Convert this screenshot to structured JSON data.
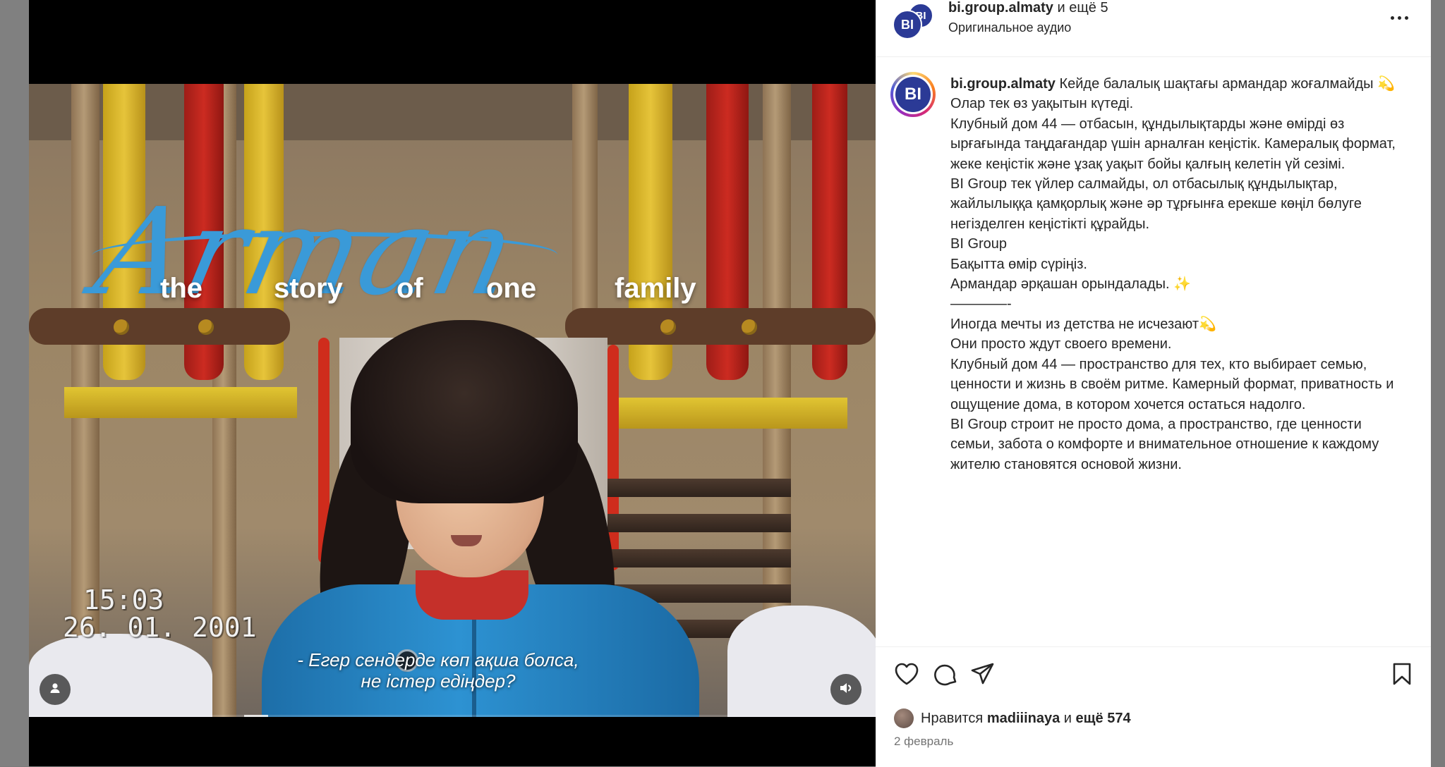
{
  "video": {
    "title_script": "Arman",
    "subtitle_words": [
      "the",
      "story",
      "of",
      "one",
      "family"
    ],
    "timestamp_time": "15:03",
    "timestamp_date": "26. 01. 2001",
    "caption_line1": "- Егер сендерде көп ақша болса,",
    "caption_line2": "не істер едіңдер?",
    "progress": 0.03
  },
  "post_header": {
    "username": "bi.group.almaty",
    "collab_text": "и ещё 5",
    "audio": "Оригинальное аудио",
    "avatar_text": "BI"
  },
  "post_caption": {
    "username": "bi.group.almaty",
    "avatar_text": "BI",
    "first_line": "Кейде балалық шақтағы армандар жоғалмайды 💫",
    "lines": [
      "Олар тек өз уақытын күтеді.",
      "",
      "Клубный дом 44 — отбасын, құндылықтарды және өмірді өз ырғағында таңдағандар үшін арналған кеңістік. Камералық формат, жеке кеңістік және ұзақ уақыт бойы қалғың келетін үй сезімі.",
      "",
      "BI Group тек үйлер салмайды, ол отбасылық құндылықтар, жайлылыққа қамқорлық және әр тұрғынға ерекше көңіл бөлуге негізделген кеңістікті құрайды.",
      "",
      "BI Group",
      "Бақытта өмір сүріңіз.",
      "Армандар әрқашан орындалады. ✨",
      "————-",
      "Иногда мечты из детства не исчезают💫",
      "Они просто ждут своего времени.",
      "",
      "Клубный дом 44 — пространство для тех, кто выбирает семью, ценности и жизнь в своём ритме. Камерный формат, приватность и ощущение дома, в котором хочется остаться надолго.",
      "",
      "BI Group строит не просто дома, а пространство, где ценности семьи, забота о комфорте и внимательное отношение к каждому жителю становятся основой жизни."
    ]
  },
  "engagement": {
    "likes_prefix": "Нравится",
    "liker": "madiiinaya",
    "likes_suffix_prefix": "и",
    "likes_more": "ещё 574",
    "date": "2 февраль"
  },
  "icons": {
    "like": "heart-icon",
    "comment": "comment-icon",
    "share": "share-icon",
    "save": "bookmark-icon",
    "more": "more-icon",
    "tag": "user-tag-icon",
    "audio": "speaker-icon"
  },
  "colors": {
    "script_title": "#3a9ad8",
    "brand": "#2b3a96",
    "text": "#262626",
    "muted": "#737373"
  }
}
